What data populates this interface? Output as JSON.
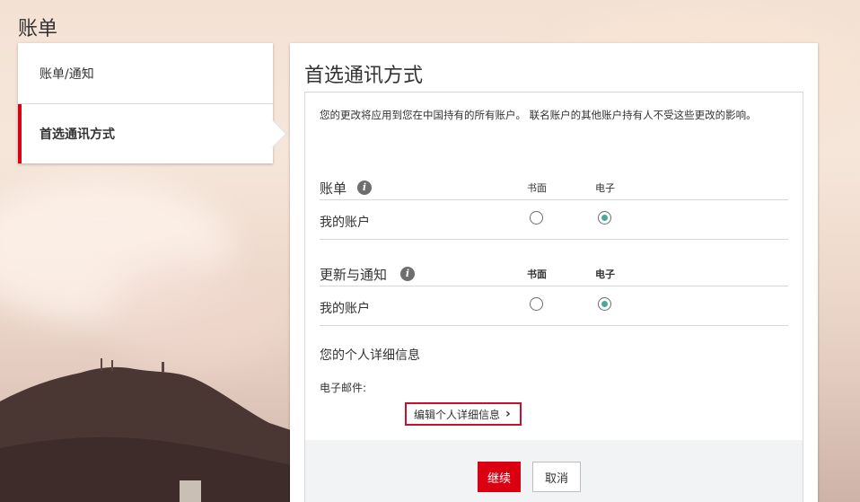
{
  "page": {
    "title": "账单"
  },
  "nav": {
    "items": [
      {
        "label": "账单/通知",
        "active": false
      },
      {
        "label": "首选通讯方式",
        "active": true
      }
    ]
  },
  "panel": {
    "title": "首选通讯方式",
    "notice": "您的更改将应用到您在中国持有的所有账户。 联名账户的其他账户持有人不受这些更改的影响。",
    "statements": {
      "title": "账单",
      "col_paper": "书面",
      "col_electronic": "电子",
      "row_label": "我的账户",
      "selected": "electronic"
    },
    "updates": {
      "title": "更新与通知",
      "col_paper": "书面",
      "col_electronic": "电子",
      "row_label": "我的账户",
      "selected": "electronic"
    },
    "details": {
      "title": "您的个人详细信息",
      "email_label": "电子邮件:",
      "edit_link": "编辑个人详细信息"
    },
    "buttons": {
      "continue": "继续",
      "cancel": "取消"
    }
  },
  "icons": {
    "info": "info-icon",
    "chevron": "chevron-right-icon"
  },
  "colors": {
    "brand_red": "#db0011",
    "radio_selected": "#4aa99b",
    "highlight_border": "#c8102e"
  }
}
